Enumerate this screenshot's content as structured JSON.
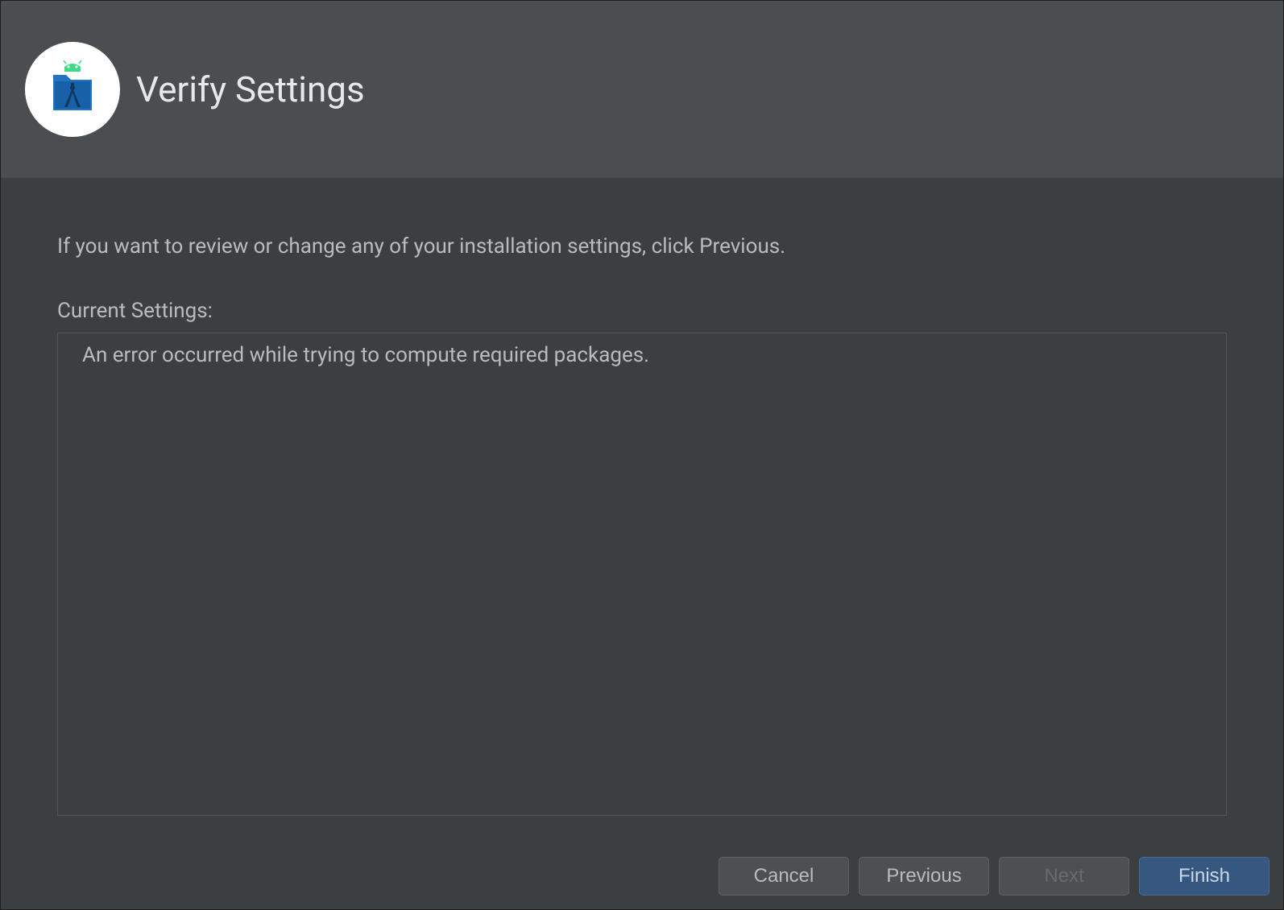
{
  "header": {
    "title": "Verify Settings"
  },
  "content": {
    "instruction": "If you want to review or change any of your installation settings, click Previous.",
    "settings_label": "Current Settings:",
    "error_message": "An error occurred while trying to compute required packages."
  },
  "buttons": {
    "cancel": "Cancel",
    "previous": "Previous",
    "next": "Next",
    "finish": "Finish"
  }
}
